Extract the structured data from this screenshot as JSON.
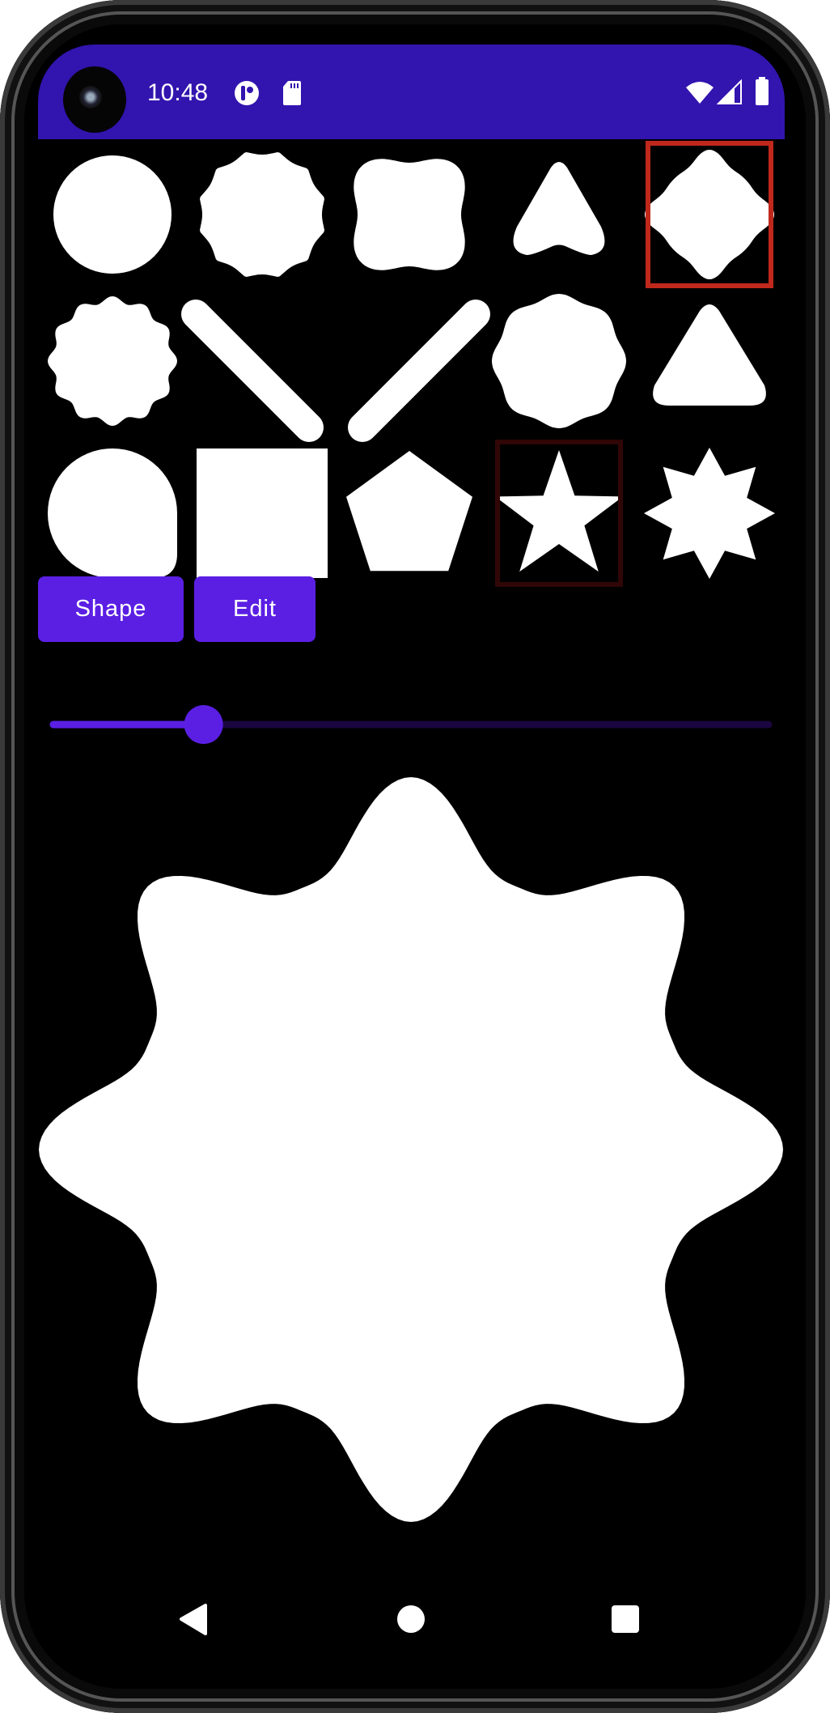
{
  "status_bar": {
    "time": "10:48",
    "background": "#3214AF",
    "left_icons": [
      "notification-app-icon",
      "sd-card-icon"
    ],
    "right_icons": [
      "wifi-icon",
      "cell-signal-icon",
      "battery-icon"
    ]
  },
  "shape_grid": {
    "shapes": [
      "circle",
      "scalloped-12",
      "puffy-square",
      "rounded-triangle",
      "pixel-star-selected",
      "wavy-circle",
      "pill-diagonal-left",
      "pill-diagonal-right",
      "clover-circle",
      "rounded-triangle-flat",
      "half-rounded-square",
      "square",
      "pentagon",
      "star-5",
      "star-8"
    ],
    "selected_index": 4,
    "highlighted_index": 13,
    "selected_color": "#C0281C",
    "highlighted_color": "#300606"
  },
  "buttons": {
    "shape_label": "Shape",
    "edit_label": "Edit",
    "color": "#5B1FE4"
  },
  "slider": {
    "value": 0.21,
    "active_color": "#5B1FE4",
    "inactive_color": "#1A0640"
  },
  "nav_bar": {
    "icons": [
      "back-icon",
      "home-icon",
      "recents-icon"
    ]
  }
}
